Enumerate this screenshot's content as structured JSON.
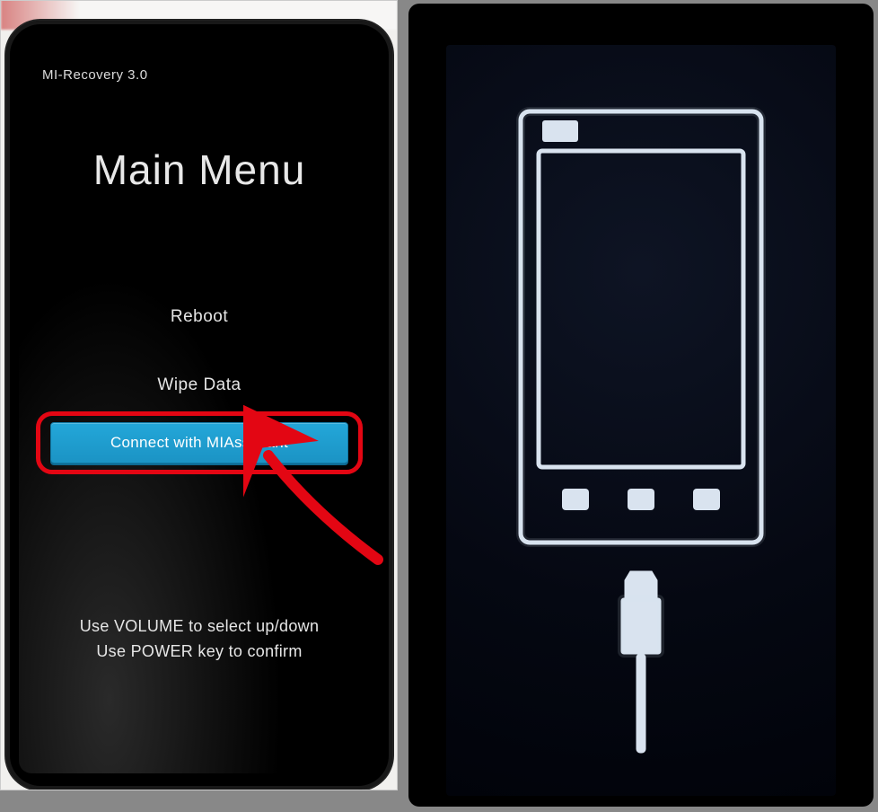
{
  "left": {
    "version": "MI-Recovery 3.0",
    "title": "Main Menu",
    "items": {
      "reboot": "Reboot",
      "wipe": "Wipe Data",
      "connect": "Connect with MIAssistant"
    },
    "hint_line1": "Use VOLUME to select up/down",
    "hint_line2": "Use POWER key to confirm"
  },
  "colors": {
    "highlight_button": "#1e9bcf",
    "annotation_red": "#e30613",
    "outline_white": "#d9e3ef"
  }
}
